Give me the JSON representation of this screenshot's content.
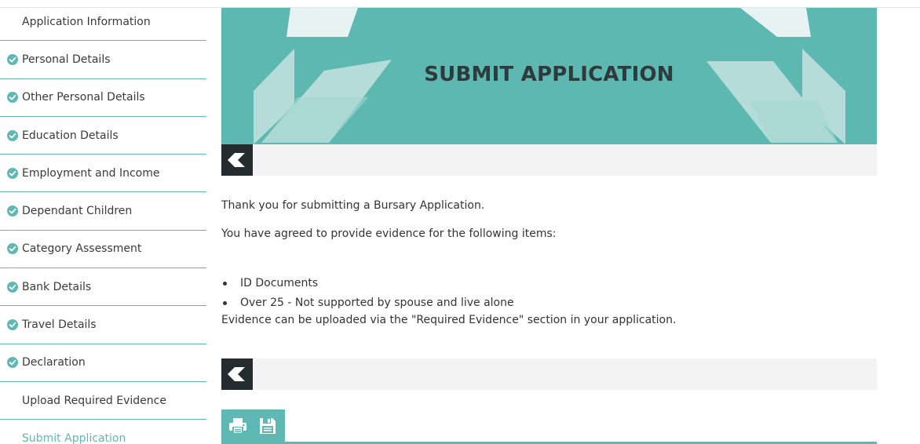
{
  "sidebar": {
    "items": [
      {
        "label": "Application Information",
        "completed": false
      },
      {
        "label": "Personal Details",
        "completed": true
      },
      {
        "label": "Other Personal Details",
        "completed": true
      },
      {
        "label": "Education Details",
        "completed": true
      },
      {
        "label": "Employment and Income",
        "completed": true
      },
      {
        "label": "Dependant Children",
        "completed": true
      },
      {
        "label": "Category Assessment",
        "completed": true
      },
      {
        "label": "Bank Details",
        "completed": true
      },
      {
        "label": "Travel Details",
        "completed": true
      },
      {
        "label": "Declaration",
        "completed": true
      },
      {
        "label": "Upload Required Evidence",
        "completed": false
      },
      {
        "label": "Submit Application",
        "completed": false,
        "active": true
      }
    ]
  },
  "banner": {
    "title": "SUBMIT APPLICATION"
  },
  "content": {
    "thank_you": "Thank you for submitting a Bursary Application.",
    "agreed_intro": "You have agreed to provide evidence for the following items:",
    "evidence_items": [
      "ID Documents",
      "Over 25 - Not supported by spouse and live alone"
    ],
    "upload_note": "Evidence can be uploaded via the \"Required Evidence\" section in your application."
  },
  "icons": {
    "back": "chevron-left-icon",
    "print": "print-icon",
    "save": "save-icon",
    "check": "check-circle-icon"
  },
  "colors": {
    "accent": "#5fb9b2",
    "banner": "#5db8b2",
    "dark": "#252c2f",
    "bar": "#f3f3f3"
  }
}
